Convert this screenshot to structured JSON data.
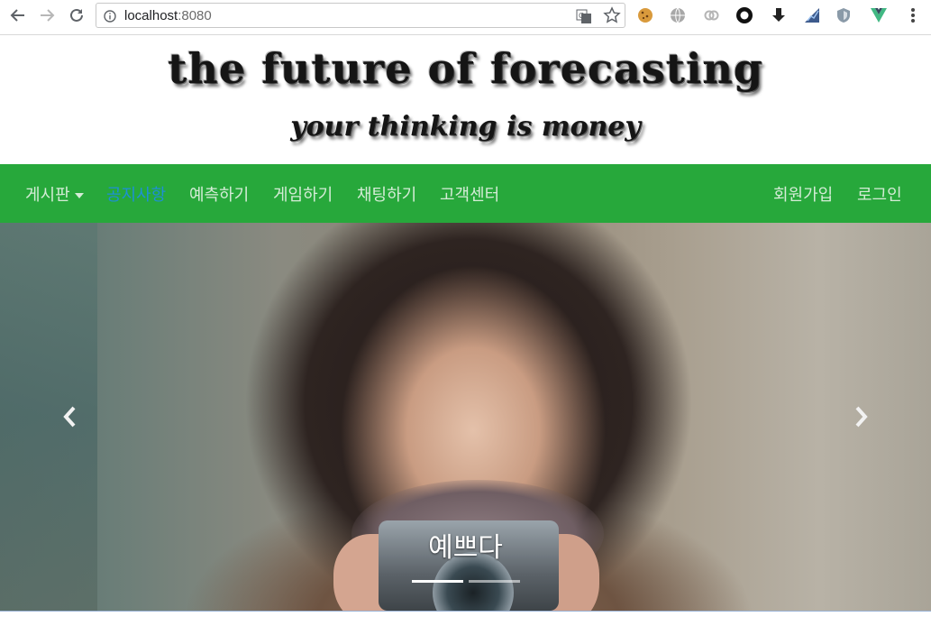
{
  "browser": {
    "url_host": "localhost",
    "url_port": ":8080",
    "icons": [
      "back-icon",
      "forward-icon",
      "reload-icon",
      "info-icon",
      "translate-icon",
      "star-icon",
      "cookie-extension-icon",
      "globe-extension-icon",
      "link-extension-icon",
      "circle-extension-icon",
      "download-extension-icon",
      "chart-extension-icon",
      "shield-extension-icon",
      "vue-devtools-icon",
      "menu-dots-icon"
    ]
  },
  "banner": {
    "title": "the future of forecasting",
    "subtitle": "your thinking is money"
  },
  "navbar": {
    "color": "#27a83b",
    "active_color": "#1e8fd6",
    "left_items": [
      {
        "label": "게시판",
        "dropdown": true
      },
      {
        "label": "공지사항",
        "active": true
      },
      {
        "label": "예측하기"
      },
      {
        "label": "게임하기"
      },
      {
        "label": "채팅하기"
      },
      {
        "label": "고객센터"
      }
    ],
    "right_items": [
      {
        "label": "회원가입"
      },
      {
        "label": "로그인"
      }
    ]
  },
  "carousel": {
    "caption": "예쁘다",
    "slide_count": 2,
    "active_slide": 1
  }
}
